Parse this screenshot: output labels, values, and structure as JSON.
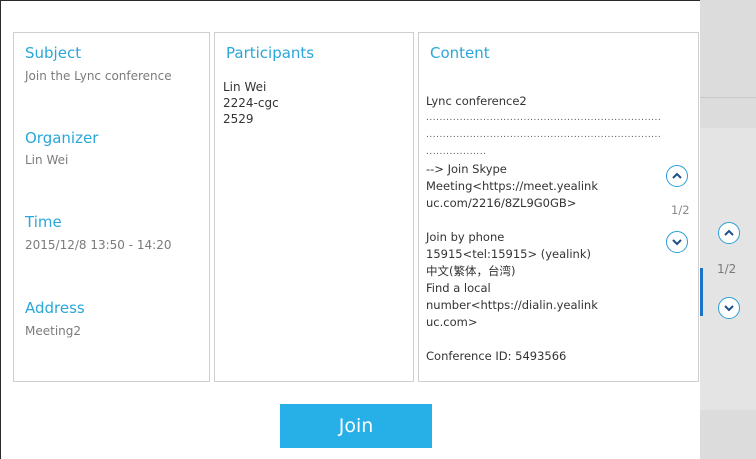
{
  "details": {
    "subject_label": "Subject",
    "subject_value": "Join the Lync conference",
    "organizer_label": "Organizer",
    "organizer_value": "Lin Wei",
    "time_label": "Time",
    "time_value": "2015/12/8 13:50 - 14:20",
    "address_label": "Address",
    "address_value": "Meeting2"
  },
  "participants": {
    "label": "Participants",
    "items": [
      "Lin Wei",
      "2224-cgc",
      "2529"
    ]
  },
  "content": {
    "label": "Content",
    "lines": [
      "Lync conference2",
      "......................................................................",
      "......................................................................",
      "..................",
      "--> Join Skype",
      "Meeting<https://meet.yealink",
      "uc.com/2216/8ZL9G0GB>",
      "",
      "Join by phone",
      "15915<tel:15915> (yealink)",
      "中文(繁体，台湾)",
      "Find a local",
      "number<https://dialin.yealink",
      "uc.com>",
      "",
      "Conference ID: 5493566"
    ],
    "page_indicator": "1/2"
  },
  "background": {
    "page_indicator": "1/2"
  },
  "actions": {
    "join_label": "Join"
  },
  "colors": {
    "accent": "#2aa7d9",
    "button": "#27b0e8"
  }
}
